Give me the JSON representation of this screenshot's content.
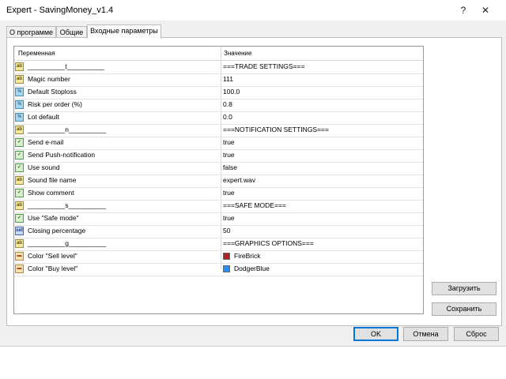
{
  "window": {
    "title": "Expert - SavingMoney_v1.4",
    "help": "?",
    "close": "✕"
  },
  "tabs": [
    {
      "label": "О программе"
    },
    {
      "label": "Общие"
    },
    {
      "label": "Входные параметры"
    }
  ],
  "grid": {
    "col_variable": "Переменная",
    "col_value": "Значение",
    "rows": [
      {
        "icon": "ab",
        "name": "__________t__________",
        "value": "===TRADE SETTINGS==="
      },
      {
        "icon": "ab",
        "name": "Magic number",
        "value": "111"
      },
      {
        "icon": "v2",
        "name": "Default Stoploss",
        "value": "100.0"
      },
      {
        "icon": "v2",
        "name": "Risk per order (%)",
        "value": "0.8"
      },
      {
        "icon": "v2",
        "name": "Lot default",
        "value": "0.0"
      },
      {
        "icon": "ab",
        "name": "__________n__________",
        "value": "===NOTIFICATION SETTINGS==="
      },
      {
        "icon": "bool",
        "name": "Send e-mail",
        "value": "true"
      },
      {
        "icon": "bool",
        "name": "Send Push-notification",
        "value": "true"
      },
      {
        "icon": "bool",
        "name": "Use sound",
        "value": "false"
      },
      {
        "icon": "ab",
        "name": "Sound file name",
        "value": "expert.wav"
      },
      {
        "icon": "bool",
        "name": "Show comment",
        "value": "true"
      },
      {
        "icon": "ab",
        "name": "__________s__________",
        "value": "===SAFE MODE==="
      },
      {
        "icon": "bool",
        "name": "Use \"Safe mode\"",
        "value": "true"
      },
      {
        "icon": "set",
        "name": "Closing percentage",
        "value": "50"
      },
      {
        "icon": "ab",
        "name": "__________g__________",
        "value": "===GRAPHICS OPTIONS==="
      },
      {
        "icon": "col",
        "name": "Color \"Sell level\"",
        "value": "FireBrick",
        "swatch": "#b22222"
      },
      {
        "icon": "col",
        "name": "Color \"Buy level\"",
        "value": "DodgerBlue",
        "swatch": "#1e90ff"
      }
    ]
  },
  "side_buttons": {
    "load": "Загрузить",
    "save": "Сохранить"
  },
  "footer_buttons": {
    "ok": "OK",
    "cancel": "Отмена",
    "reset": "Сброс"
  },
  "icon_labels": {
    "ab": "ab",
    "v2": "½",
    "bool": "✓",
    "set": "set",
    "col": "▬"
  }
}
